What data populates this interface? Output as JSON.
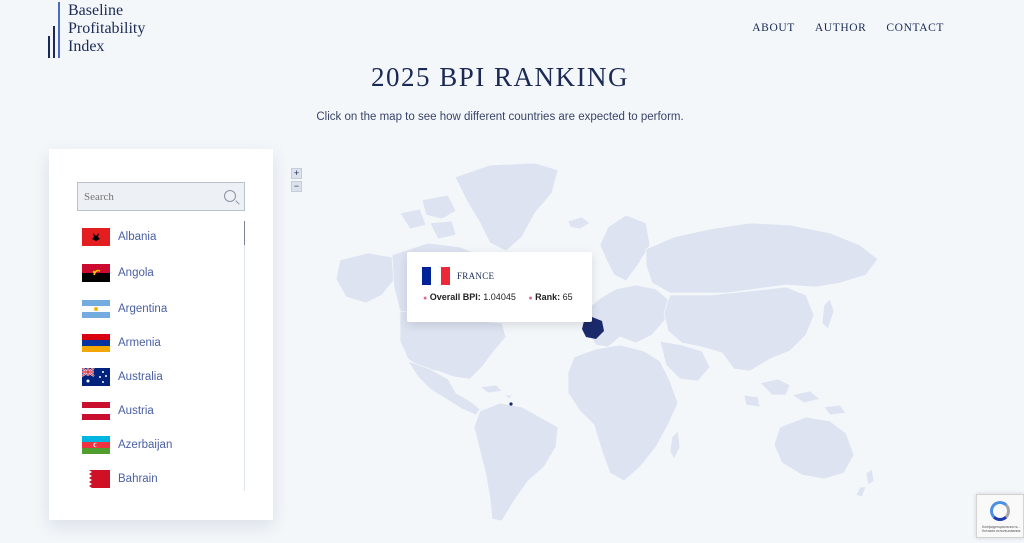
{
  "brand": {
    "line1": "Baseline",
    "line2": "Profitability",
    "line3": "Index"
  },
  "nav": {
    "about": "ABOUT",
    "author": "AUTHOR",
    "contact": "CONTACT"
  },
  "page": {
    "title": "2025 BPI RANKING",
    "subtitle": "Click on the map to see how different countries are expected to perform."
  },
  "search": {
    "placeholder": "Search"
  },
  "countries": [
    {
      "name": "Albania"
    },
    {
      "name": "Angola"
    },
    {
      "name": "Argentina"
    },
    {
      "name": "Armenia"
    },
    {
      "name": "Australia"
    },
    {
      "name": "Austria"
    },
    {
      "name": "Azerbaijan"
    },
    {
      "name": "Bahrain"
    }
  ],
  "zoom": {
    "in": "+",
    "out": "−"
  },
  "tooltip": {
    "country": "FRANCE",
    "bpi_label": "Overall BPI:",
    "bpi_value": "1.04045",
    "rank_label": "Rank:",
    "rank_value": "65"
  },
  "recaptcha": {
    "text": "Конфиденциальность - Условия использования"
  },
  "colors": {
    "background": "#f3f7fa",
    "land": "#dde3f1",
    "highlight": "#1b2a6b",
    "text_dark": "#1b2a55",
    "link": "#4a5fa3"
  },
  "icons": [
    "search-icon",
    "plus-icon",
    "minus-icon",
    "recaptcha-icon"
  ]
}
